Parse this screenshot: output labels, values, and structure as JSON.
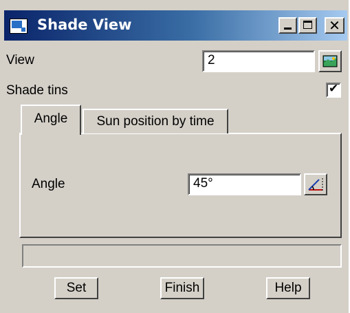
{
  "window": {
    "title": "Shade View"
  },
  "titlebar": {
    "minimize_icon": "minimize-icon",
    "maximize_icon": "maximize-icon",
    "close_glyph": "✕"
  },
  "view": {
    "label": "View",
    "value": "2",
    "picker_icon": "view-picker-icon"
  },
  "shade_tins": {
    "label": "Shade tins",
    "checked": true,
    "check_glyph": "✔"
  },
  "tabs": [
    {
      "label": "Angle",
      "active": true
    },
    {
      "label": "Sun position by time",
      "active": false
    }
  ],
  "angle": {
    "label": "Angle",
    "value": "45°",
    "picker_icon": "angle-picker-icon"
  },
  "status": {
    "text": ""
  },
  "buttons": {
    "set": "Set",
    "finish": "Finish",
    "help": "Help"
  }
}
